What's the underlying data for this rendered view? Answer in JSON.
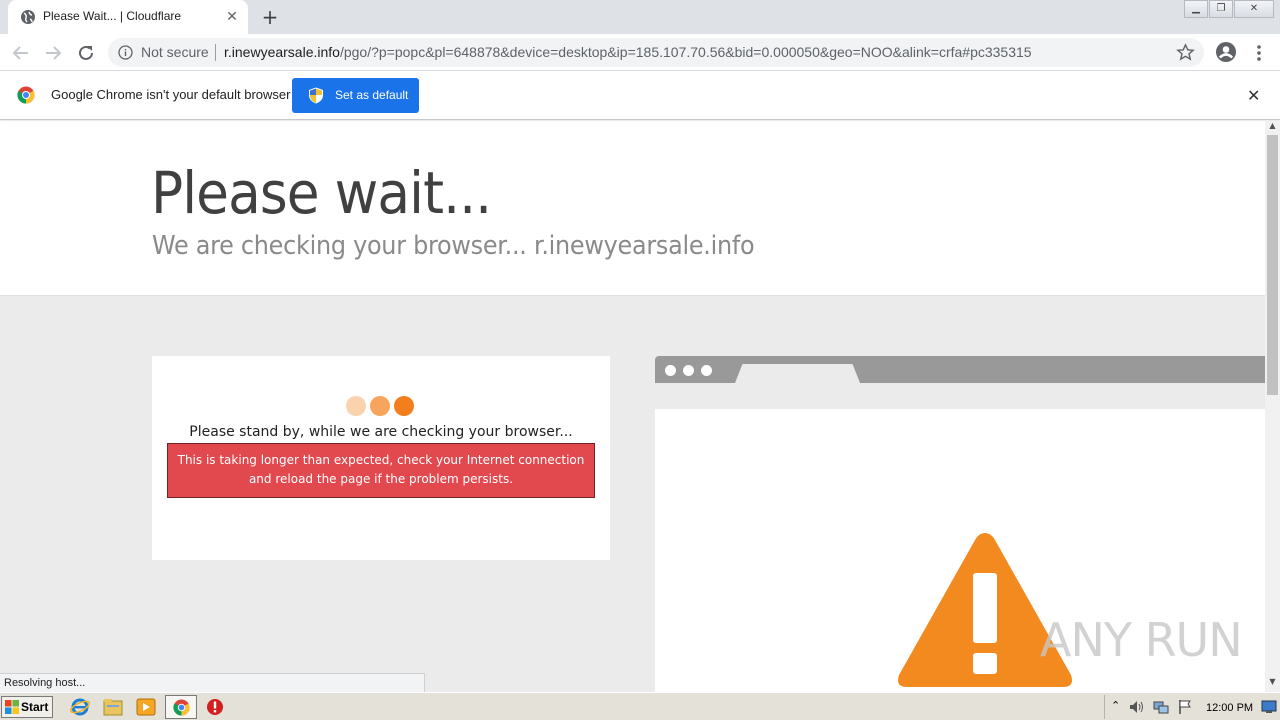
{
  "browser": {
    "tab_title": "Please Wait... | Cloudflare",
    "tab_close": "✕",
    "new_tab": "+",
    "not_secure": "Not secure",
    "url_host": "r.inewyearsale.info",
    "url_rest": "/pgo/?p=popc&pl=648878&device=desktop&ip=185.107.70.56&bid=0.000050&geo=NOO&alink=crfa#pc335315",
    "infobar_message": "Google Chrome isn't your default browser",
    "set_default_label": "Set as default",
    "infobar_close": "✕",
    "status_text": "Resolving host..."
  },
  "page": {
    "heading": "Please wait...",
    "subheading": "We are checking your browser... r.inewyearsale.info",
    "standby": "Please stand by, while we are checking your browser...",
    "error_line1": "This is taking longer than expected, check your Internet connection",
    "error_line2": "and reload the page if the problem persists.",
    "watermark": "ANY RUN"
  },
  "taskbar": {
    "start_label": "Start",
    "clock": "12:00 PM"
  },
  "colors": {
    "dot1": "#fbd2ae",
    "dot2": "#f7a45c",
    "dot3": "#f27e1c",
    "error_bg": "#e2494f",
    "warning": "#f38a20",
    "accent": "#1a73e8"
  }
}
